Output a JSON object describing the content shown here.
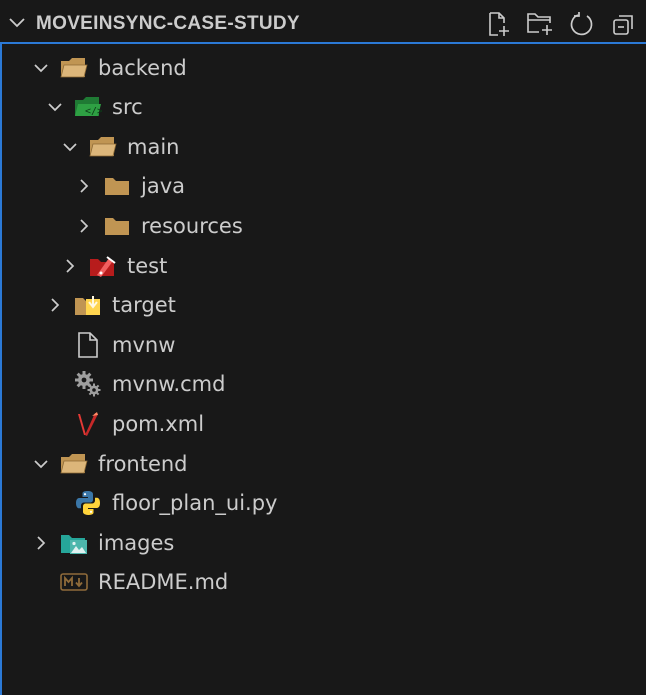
{
  "explorer": {
    "title": "MOVEINSYNC-CASE-STUDY",
    "actions": [
      {
        "name": "new-file-icon",
        "label": "New File"
      },
      {
        "name": "new-folder-icon",
        "label": "New Folder"
      },
      {
        "name": "refresh-icon",
        "label": "Refresh Explorer"
      },
      {
        "name": "collapse-all-icon",
        "label": "Collapse Folders in Explorer"
      }
    ],
    "items": [
      {
        "label": "backend",
        "type": "folder",
        "expanded": true,
        "icon": "folder-open-icon"
      },
      {
        "label": "src",
        "type": "folder",
        "expanded": true,
        "icon": "folder-src-icon"
      },
      {
        "label": "main",
        "type": "folder",
        "expanded": true,
        "icon": "folder-open-icon"
      },
      {
        "label": "java",
        "type": "folder",
        "expanded": false,
        "icon": "folder-icon"
      },
      {
        "label": "resources",
        "type": "folder",
        "expanded": false,
        "icon": "folder-icon"
      },
      {
        "label": "test",
        "type": "folder",
        "expanded": false,
        "icon": "folder-test-icon"
      },
      {
        "label": "target",
        "type": "folder",
        "expanded": false,
        "icon": "folder-target-icon"
      },
      {
        "label": "mvnw",
        "type": "file",
        "icon": "file-icon"
      },
      {
        "label": "mvnw.cmd",
        "type": "file",
        "icon": "gears-icon"
      },
      {
        "label": "pom.xml",
        "type": "file",
        "icon": "maven-icon"
      },
      {
        "label": "frontend",
        "type": "folder",
        "expanded": true,
        "icon": "folder-open-icon"
      },
      {
        "label": "floor_plan_ui.py",
        "type": "file",
        "icon": "python-icon"
      },
      {
        "label": "images",
        "type": "folder",
        "expanded": false,
        "icon": "folder-images-icon"
      },
      {
        "label": "README.md",
        "type": "file",
        "icon": "markdown-icon"
      }
    ]
  },
  "colors": {
    "background": "#181818",
    "focus_border": "#2b79d6",
    "text": "#cccccc",
    "folder": "#c09553"
  }
}
